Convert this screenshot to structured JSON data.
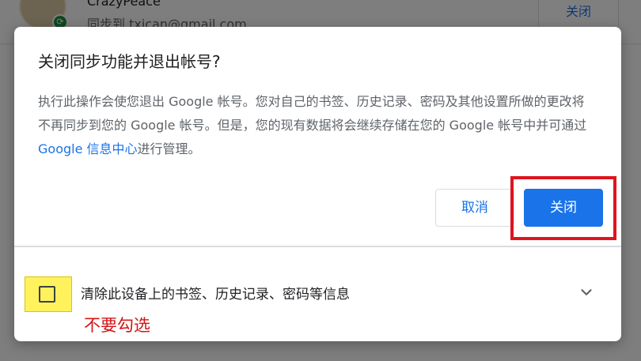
{
  "background": {
    "profile_name": "CrazyPeace",
    "profile_email": "同步到 txican@gmail.com",
    "sync_icon": "sync-icon",
    "close_button_label": "关闭"
  },
  "dialog": {
    "title": "关闭同步功能并退出帐号?",
    "body_part1": "执行此操作会使您退出 Google 帐号。您对自己的书签、历史记录、密码及其他设置所做的更改将不再同步到您的 Google 帐号。但是，您的现有数据将会继续存储在您的 Google 帐号中并可通过 ",
    "body_link": "Google 信息中心",
    "body_part2": "进行管理。",
    "cancel_label": "取消",
    "confirm_label": "关闭",
    "checkbox_label": "清除此设备上的书签、历史记录、密码等信息",
    "checkbox_checked": false,
    "expand_icon": "chevron-down-icon"
  },
  "annotation": {
    "note": "不要勾选"
  },
  "colors": {
    "accent": "#1a73e8",
    "annotation_red": "#e0141e",
    "highlight_yellow": "#fff25c"
  }
}
